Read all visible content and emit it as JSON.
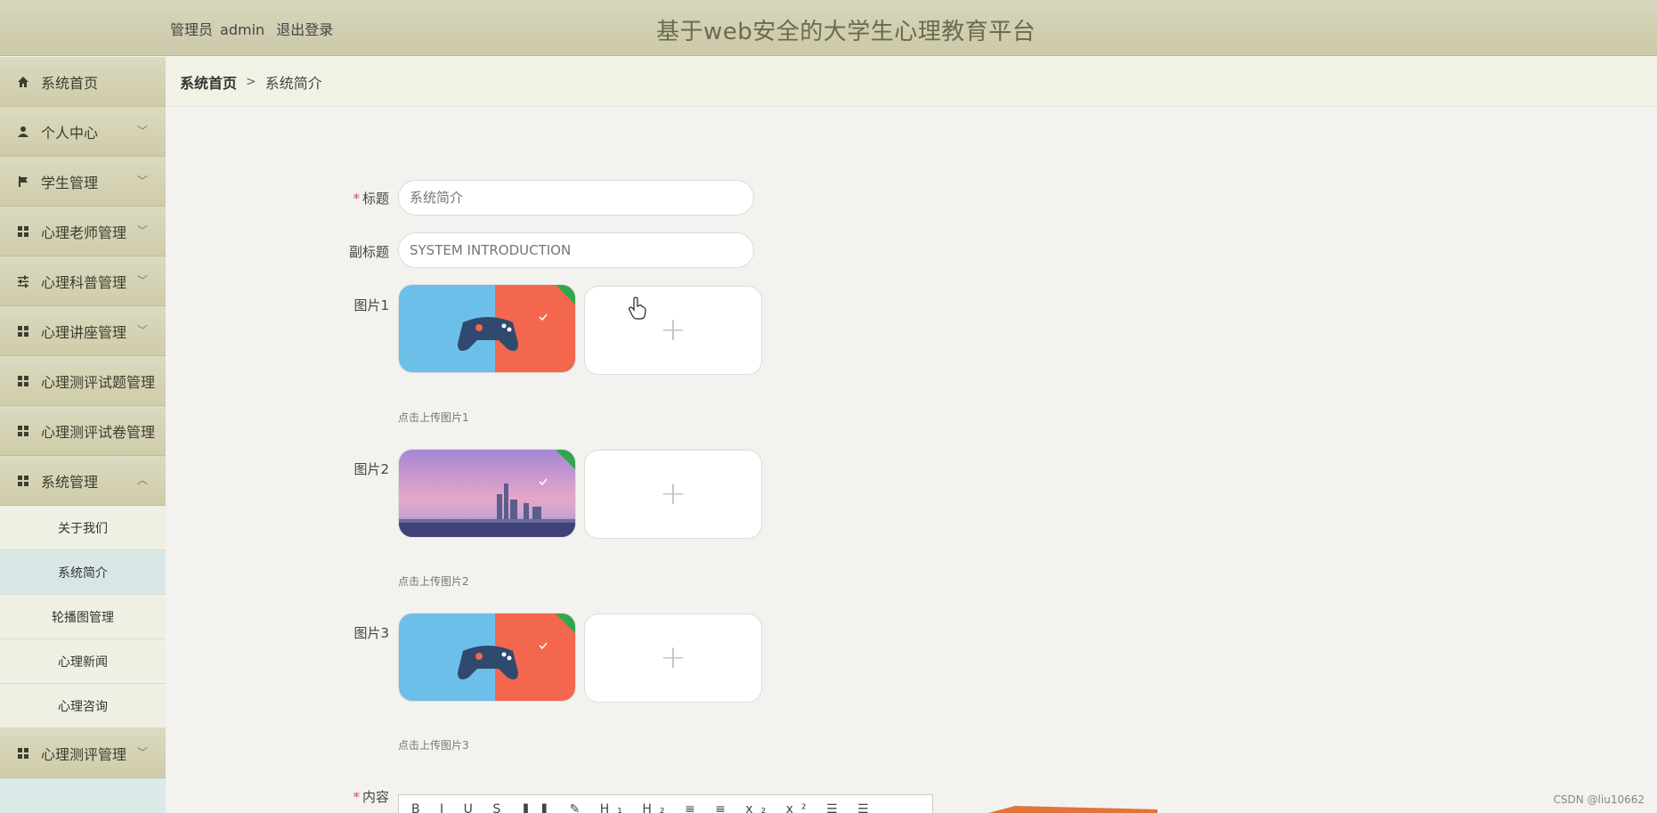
{
  "header": {
    "role": "管理员",
    "username": "admin",
    "logout": "退出登录",
    "title": "基于web安全的大学生心理教育平台"
  },
  "sidebar": {
    "items": [
      {
        "label": "系统首页",
        "icon": "home-icon"
      },
      {
        "label": "个人中心",
        "icon": "user-icon"
      },
      {
        "label": "学生管理",
        "icon": "flag-icon"
      },
      {
        "label": "心理老师管理",
        "icon": "grid-icon"
      },
      {
        "label": "心理科普管理",
        "icon": "sliders-icon"
      },
      {
        "label": "心理讲座管理",
        "icon": "grid-icon"
      },
      {
        "label": "心理测评试题管理",
        "icon": "grid-icon"
      },
      {
        "label": "心理测评试卷管理",
        "icon": "grid-icon"
      },
      {
        "label": "系统管理",
        "icon": "grid-icon"
      },
      {
        "label": "心理测评管理",
        "icon": "grid-icon"
      }
    ],
    "sub_items": [
      "关于我们",
      "系统简介",
      "轮播图管理",
      "心理新闻",
      "心理咨询"
    ],
    "active_sub": "系统简介"
  },
  "breadcrumb": {
    "home": "系统首页",
    "separator": ">",
    "current": "系统简介"
  },
  "form": {
    "title_label": "标题",
    "title_placeholder": "系统简介",
    "subtitle_label": "副标题",
    "subtitle_placeholder": "SYSTEM INTRODUCTION",
    "image1_label": "图片1",
    "image1_hint": "点击上传图片1",
    "image2_label": "图片2",
    "image2_hint": "点击上传图片2",
    "image3_label": "图片3",
    "image3_hint": "点击上传图片3",
    "content_label": "内容",
    "editor_toolbar": "B I U S ❚❚ ✎ H₁ H₂ ≡ ≡ x₂ x² ☰ ☰"
  },
  "watermark": "CSDN @liu10662",
  "colors": {
    "header_bg": "#d3d1b2",
    "sidebar_bg": "#d4d2b3",
    "active_sub_bg": "#d8e7e6",
    "required": "#e14b4b",
    "title_color": "#6b6a4f"
  }
}
